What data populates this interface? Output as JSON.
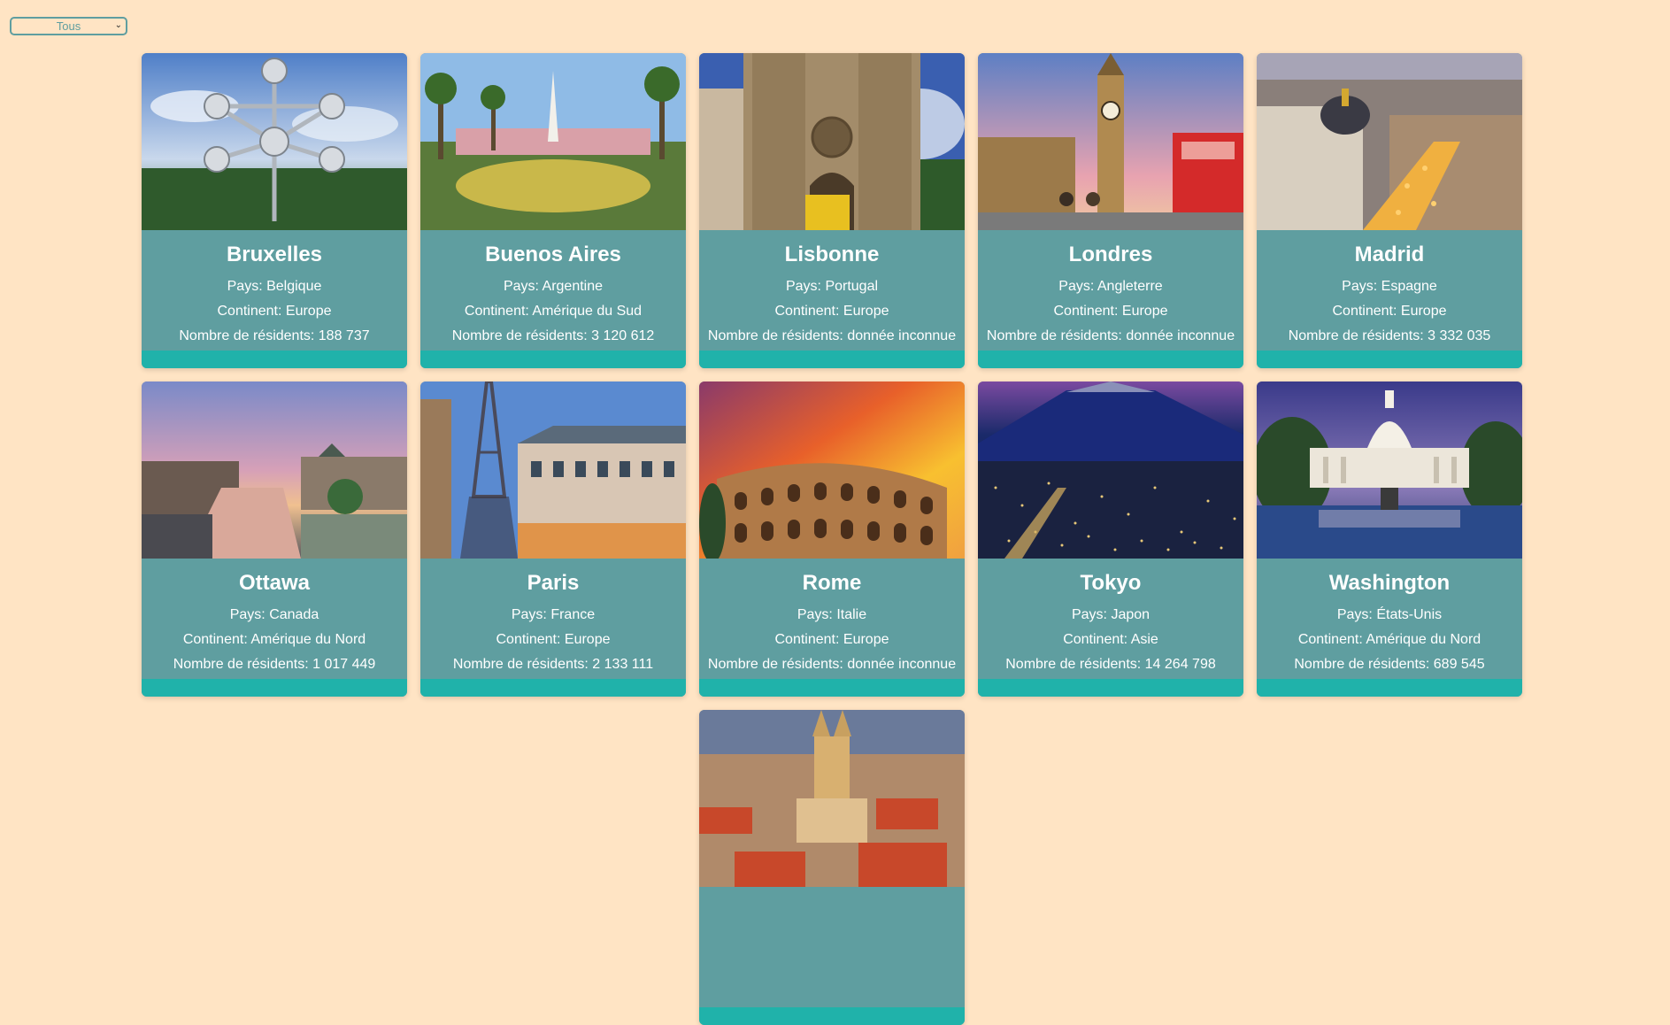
{
  "filter": {
    "selected": "Tous"
  },
  "labels": {
    "country": "Pays: ",
    "continent": "Continent: ",
    "residents": "Nombre de résidents: "
  },
  "cities": [
    {
      "name": "Bruxelles",
      "country": "Belgique",
      "continent": "Europe",
      "residents": "188 737"
    },
    {
      "name": "Buenos Aires",
      "country": "Argentine",
      "continent": "Amérique du Sud",
      "residents": "3 120 612"
    },
    {
      "name": "Lisbonne",
      "country": "Portugal",
      "continent": "Europe",
      "residents": "donnée inconnue"
    },
    {
      "name": "Londres",
      "country": "Angleterre",
      "continent": "Europe",
      "residents": "donnée inconnue"
    },
    {
      "name": "Madrid",
      "country": "Espagne",
      "continent": "Europe",
      "residents": "3 332 035"
    },
    {
      "name": "Ottawa",
      "country": "Canada",
      "continent": "Amérique du Nord",
      "residents": "1 017 449"
    },
    {
      "name": "Paris",
      "country": "France",
      "continent": "Europe",
      "residents": "2 133 111"
    },
    {
      "name": "Rome",
      "country": "Italie",
      "continent": "Europe",
      "residents": "donnée inconnue"
    },
    {
      "name": "Tokyo",
      "country": "Japon",
      "continent": "Asie",
      "residents": "14 264 798"
    },
    {
      "name": "Washington",
      "country": "États-Unis",
      "continent": "Amérique du Nord",
      "residents": "689 545"
    },
    {
      "name": "",
      "country": "",
      "continent": "",
      "residents": ""
    }
  ],
  "colors": {
    "page_bg": "#ffe4c4",
    "card_bg": "#5f9ea0",
    "card_footer": "#20b2aa",
    "text": "#ffffff"
  }
}
